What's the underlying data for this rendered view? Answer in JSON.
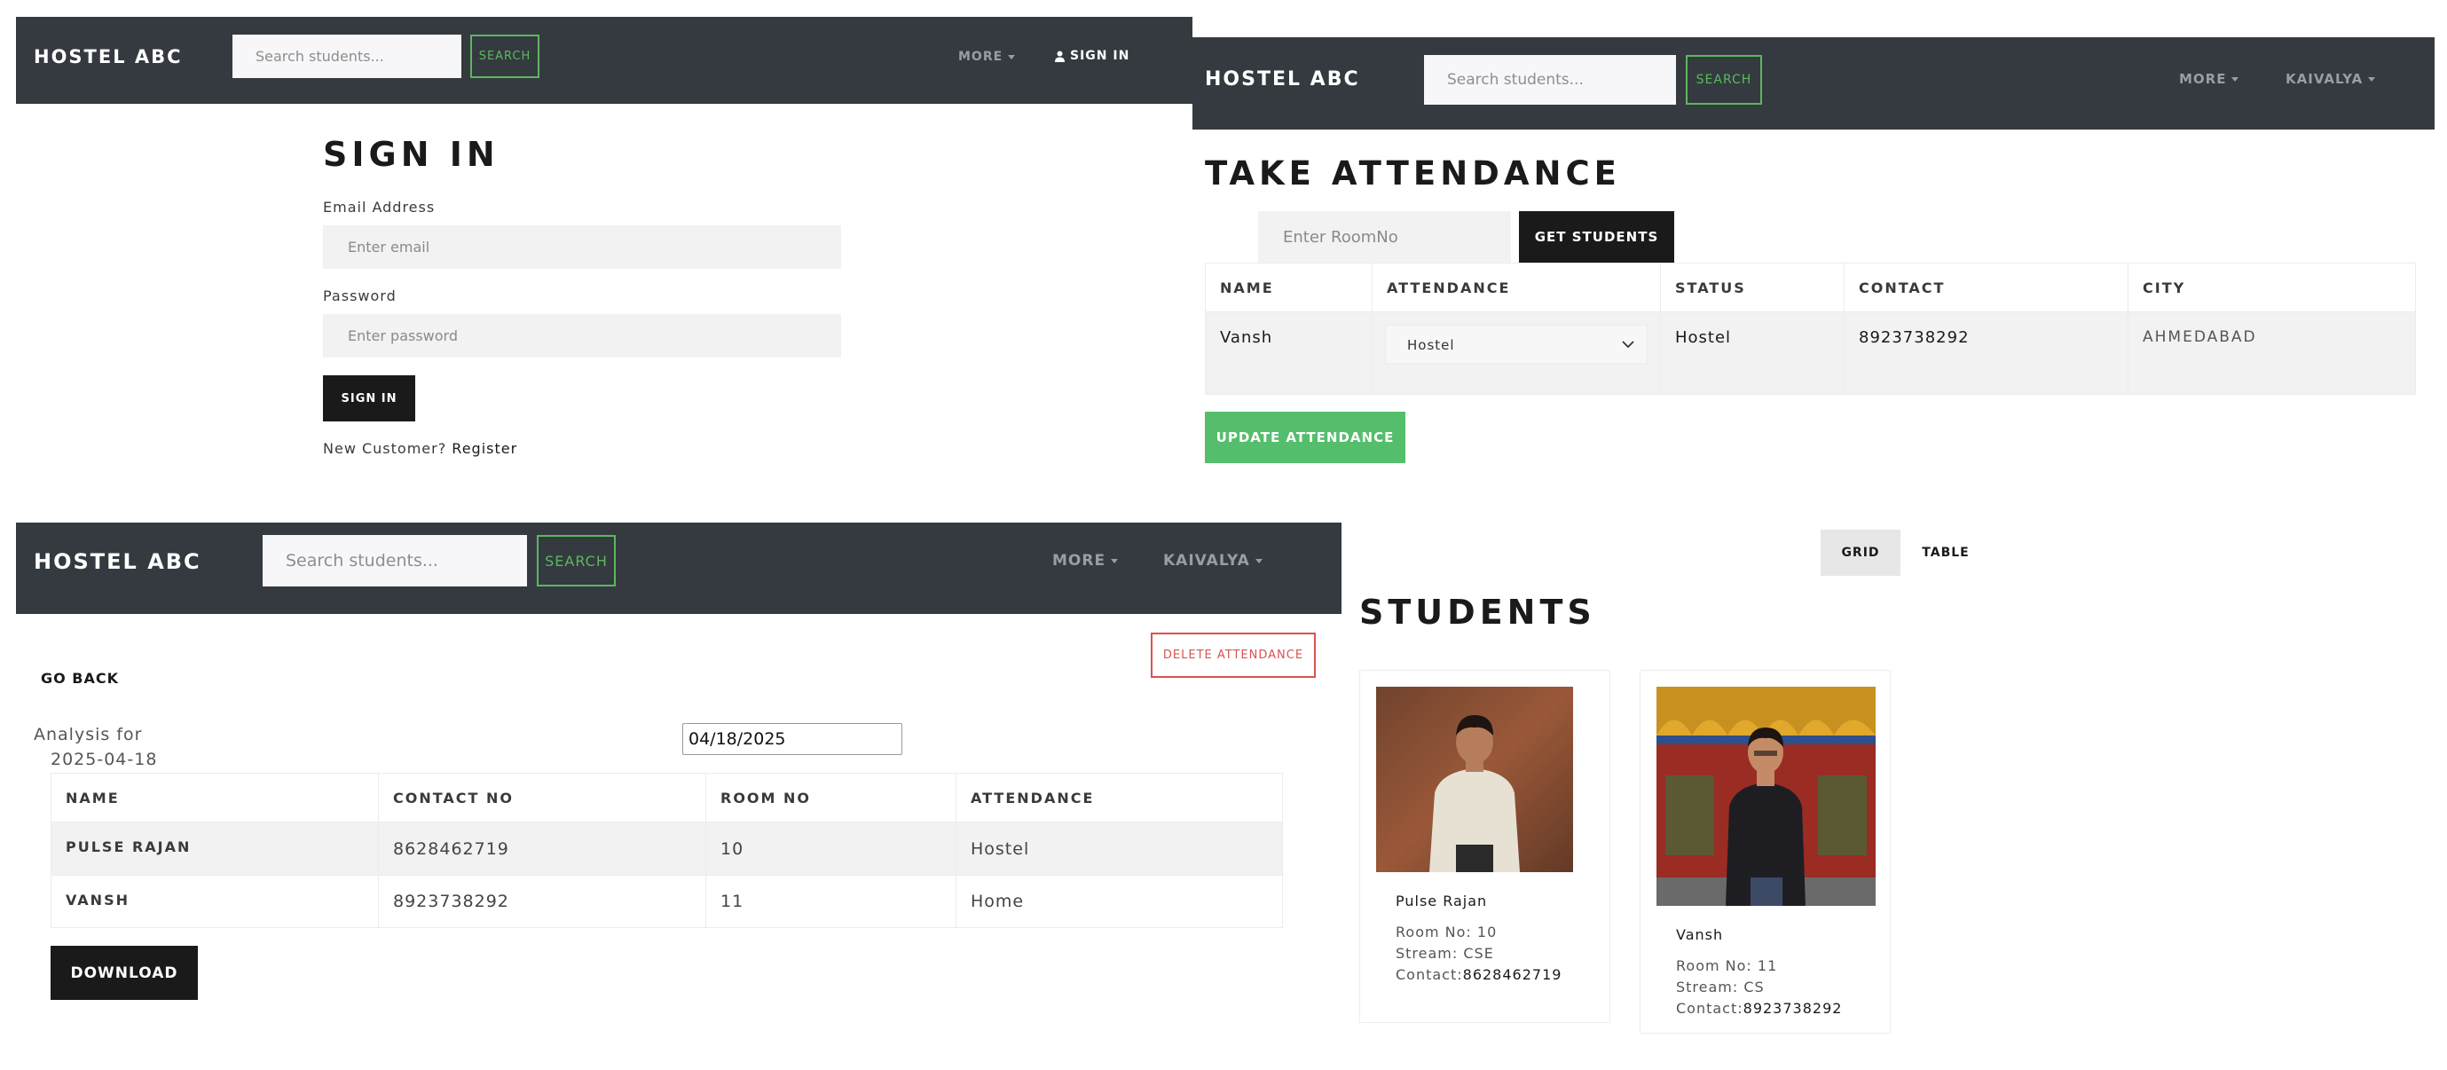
{
  "app": {
    "brand": "HOSTEL ABC"
  },
  "nav": {
    "search_placeholder": "Search students...",
    "search_button": "SEARCH",
    "more": "MORE",
    "sign_in": "SIGN IN",
    "user": "KAIVALYA"
  },
  "signin": {
    "title": "SIGN IN",
    "email_label": "Email Address",
    "email_placeholder": "Enter email",
    "password_label": "Password",
    "password_placeholder": "Enter password",
    "button": "SIGN IN",
    "new_customer": "New Customer?",
    "register": "Register"
  },
  "take_attendance": {
    "title": "TAKE ATTENDANCE",
    "room_placeholder": "Enter RoomNo",
    "get_students": "GET STUDENTS",
    "columns": [
      "NAME",
      "ATTENDANCE",
      "STATUS",
      "CONTACT",
      "CITY"
    ],
    "rows": [
      {
        "name": "Vansh",
        "attendance": "Hostel",
        "status": "Hostel",
        "contact": "8923738292",
        "city": "AHMEDABAD"
      }
    ],
    "update_button": "UPDATE ATTENDANCE"
  },
  "analysis": {
    "go_back": "GO BACK",
    "delete_button": "DELETE ATTENDANCE",
    "analysis_for": "Analysis for",
    "date_label": "2025-04-18",
    "date_value": "04/18/2025",
    "columns": [
      "NAME",
      "CONTACT NO",
      "ROOM NO",
      "ATTENDANCE"
    ],
    "rows": [
      {
        "name": "PULSE RAJAN",
        "contact": "8628462719",
        "room": "10",
        "attendance": "Hostel"
      },
      {
        "name": "VANSH",
        "contact": "8923738292",
        "room": "11",
        "attendance": "Home"
      }
    ],
    "download": "DOWNLOAD"
  },
  "students": {
    "grid_tab": "GRID",
    "table_tab": "TABLE",
    "title": "STUDENTS",
    "cards": [
      {
        "name": "Pulse Rajan",
        "room": "Room No: 10",
        "stream": "Stream: CSE",
        "contact_label": "Contact:",
        "contact": "8628462719"
      },
      {
        "name": "Vansh",
        "room": "Room No: 11",
        "stream": "Stream: CS",
        "contact_label": "Contact:",
        "contact": "8923738292"
      }
    ]
  },
  "colors": {
    "navbar": "#343a40",
    "accent_green": "#55be6c",
    "danger_red": "#d9534f",
    "dark_button": "#1a1a1a"
  }
}
